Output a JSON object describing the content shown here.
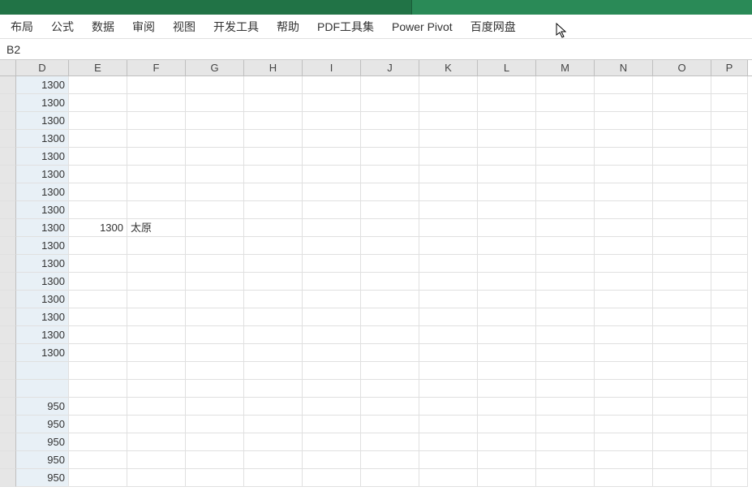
{
  "menu": {
    "items": [
      "布局",
      "公式",
      "数据",
      "审阅",
      "视图",
      "开发工具",
      "帮助",
      "PDF工具集",
      "Power Pivot",
      "百度网盘"
    ]
  },
  "name_box": {
    "value": "B2"
  },
  "columns": [
    "D",
    "E",
    "F",
    "G",
    "H",
    "I",
    "J",
    "K",
    "L",
    "M",
    "N",
    "O",
    "P"
  ],
  "grid": {
    "rows": [
      {
        "D": "1300",
        "E": "",
        "F": ""
      },
      {
        "D": "1300",
        "E": "",
        "F": ""
      },
      {
        "D": "1300",
        "E": "",
        "F": ""
      },
      {
        "D": "1300",
        "E": "",
        "F": ""
      },
      {
        "D": "1300",
        "E": "",
        "F": ""
      },
      {
        "D": "1300",
        "E": "",
        "F": ""
      },
      {
        "D": "1300",
        "E": "",
        "F": ""
      },
      {
        "D": "1300",
        "E": "",
        "F": ""
      },
      {
        "D": "1300",
        "E": "1300",
        "F": "太原"
      },
      {
        "D": "1300",
        "E": "",
        "F": ""
      },
      {
        "D": "1300",
        "E": "",
        "F": ""
      },
      {
        "D": "1300",
        "E": "",
        "F": ""
      },
      {
        "D": "1300",
        "E": "",
        "F": ""
      },
      {
        "D": "1300",
        "E": "",
        "F": ""
      },
      {
        "D": "1300",
        "E": "",
        "F": ""
      },
      {
        "D": "1300",
        "E": "",
        "F": ""
      },
      {
        "D": "",
        "E": "",
        "F": ""
      },
      {
        "D": "",
        "E": "",
        "F": ""
      },
      {
        "D": "950",
        "E": "",
        "F": ""
      },
      {
        "D": "950",
        "E": "",
        "F": ""
      },
      {
        "D": "950",
        "E": "",
        "F": ""
      },
      {
        "D": "950",
        "E": "",
        "F": ""
      },
      {
        "D": "950",
        "E": "",
        "F": ""
      }
    ]
  }
}
